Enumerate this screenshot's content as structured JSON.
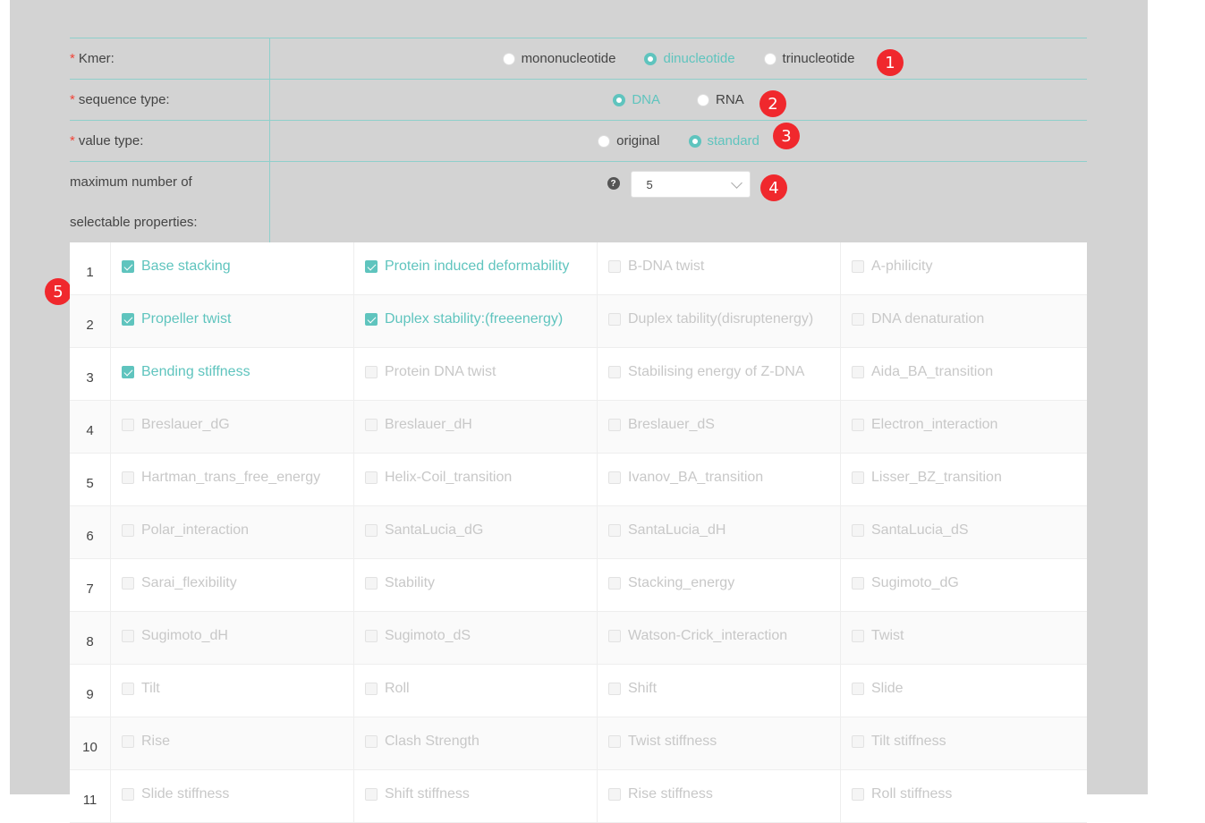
{
  "form": {
    "kmer": {
      "label": "Kmer:",
      "options": [
        "mononucleotide",
        "dinucleotide",
        "trinucleotide"
      ],
      "selected": 1,
      "badge": "1"
    },
    "sequence_type": {
      "label": "sequence type:",
      "options": [
        "DNA",
        "RNA"
      ],
      "selected": 0,
      "badge": "2"
    },
    "value_type": {
      "label": "value type:",
      "options": [
        "original",
        "standard"
      ],
      "selected": 1,
      "badge": "3"
    },
    "max_props": {
      "label_line1": "maximum number of",
      "label_line2": "selectable properties:",
      "help": "?",
      "select_value": "5",
      "badge": "4"
    }
  },
  "grid_badge": "5",
  "colors": {
    "accent": "#5fc4be",
    "badge": "#f0282d",
    "panel": "#d3d3d3"
  },
  "properties": [
    {
      "num": "1",
      "cells": [
        {
          "label": "Base stacking",
          "checked": true
        },
        {
          "label": "Protein induced deformability",
          "checked": true
        },
        {
          "label": "B-DNA twist",
          "checked": false
        },
        {
          "label": "A-philicity",
          "checked": false
        }
      ]
    },
    {
      "num": "2",
      "cells": [
        {
          "label": "Propeller twist",
          "checked": true
        },
        {
          "label": "Duplex stability:(freeenergy)",
          "checked": true
        },
        {
          "label": "Duplex tability(disruptenergy)",
          "checked": false
        },
        {
          "label": "DNA denaturation",
          "checked": false
        }
      ]
    },
    {
      "num": "3",
      "cells": [
        {
          "label": "Bending stiffness",
          "checked": true
        },
        {
          "label": "Protein DNA twist",
          "checked": false
        },
        {
          "label": "Stabilising energy of Z-DNA",
          "checked": false
        },
        {
          "label": "Aida_BA_transition",
          "checked": false
        }
      ]
    },
    {
      "num": "4",
      "cells": [
        {
          "label": "Breslauer_dG",
          "checked": false
        },
        {
          "label": "Breslauer_dH",
          "checked": false
        },
        {
          "label": "Breslauer_dS",
          "checked": false
        },
        {
          "label": "Electron_interaction",
          "checked": false
        }
      ]
    },
    {
      "num": "5",
      "cells": [
        {
          "label": "Hartman_trans_free_energy",
          "checked": false
        },
        {
          "label": "Helix-Coil_transition",
          "checked": false
        },
        {
          "label": "Ivanov_BA_transition",
          "checked": false
        },
        {
          "label": "Lisser_BZ_transition",
          "checked": false
        }
      ]
    },
    {
      "num": "6",
      "cells": [
        {
          "label": "Polar_interaction",
          "checked": false
        },
        {
          "label": "SantaLucia_dG",
          "checked": false
        },
        {
          "label": "SantaLucia_dH",
          "checked": false
        },
        {
          "label": "SantaLucia_dS",
          "checked": false
        }
      ]
    },
    {
      "num": "7",
      "cells": [
        {
          "label": "Sarai_flexibility",
          "checked": false
        },
        {
          "label": "Stability",
          "checked": false
        },
        {
          "label": "Stacking_energy",
          "checked": false
        },
        {
          "label": "Sugimoto_dG",
          "checked": false
        }
      ]
    },
    {
      "num": "8",
      "cells": [
        {
          "label": "Sugimoto_dH",
          "checked": false
        },
        {
          "label": "Sugimoto_dS",
          "checked": false
        },
        {
          "label": "Watson-Crick_interaction",
          "checked": false
        },
        {
          "label": "Twist",
          "checked": false
        }
      ]
    },
    {
      "num": "9",
      "cells": [
        {
          "label": "Tilt",
          "checked": false
        },
        {
          "label": "Roll",
          "checked": false
        },
        {
          "label": "Shift",
          "checked": false
        },
        {
          "label": "Slide",
          "checked": false
        }
      ]
    },
    {
      "num": "10",
      "cells": [
        {
          "label": "Rise",
          "checked": false
        },
        {
          "label": "Clash Strength",
          "checked": false
        },
        {
          "label": "Twist stiffness",
          "checked": false
        },
        {
          "label": "Tilt stiffness",
          "checked": false
        }
      ]
    },
    {
      "num": "11",
      "cells": [
        {
          "label": "Slide stiffness",
          "checked": false
        },
        {
          "label": "Shift stiffness",
          "checked": false
        },
        {
          "label": "Rise stiffness",
          "checked": false
        },
        {
          "label": "Roll stiffness",
          "checked": false
        }
      ]
    }
  ]
}
